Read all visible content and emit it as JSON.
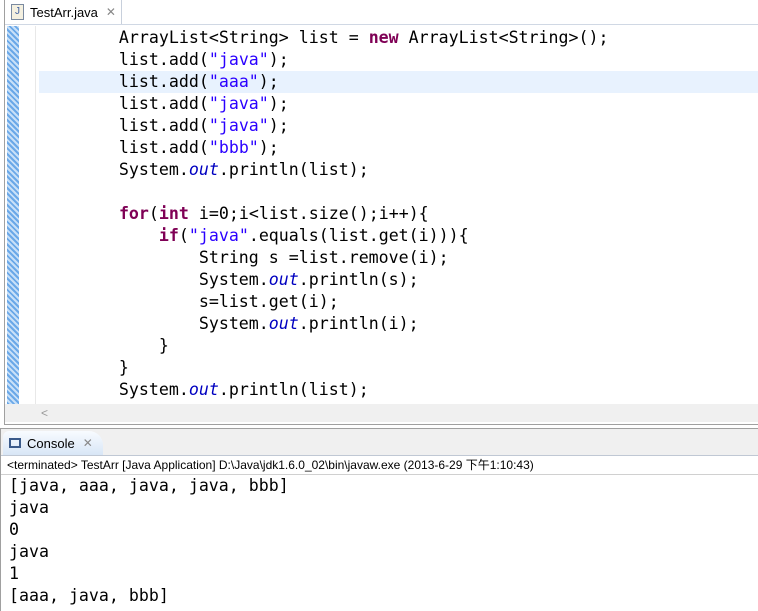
{
  "editor": {
    "tab_label": "TestArr.java",
    "code": [
      [
        [
          "",
          "        ArrayList<String> list = "
        ],
        [
          "kw",
          "new"
        ],
        [
          "",
          " ArrayList<String>();"
        ]
      ],
      [
        [
          "",
          "        list.add("
        ],
        [
          "str",
          "\"java\""
        ],
        [
          "",
          ");"
        ]
      ],
      [
        [
          "",
          "        list.add("
        ],
        [
          "str",
          "\"aaa\""
        ],
        [
          "",
          ");"
        ]
      ],
      [
        [
          "",
          "        list.add("
        ],
        [
          "str",
          "\"java\""
        ],
        [
          "",
          ");"
        ]
      ],
      [
        [
          "",
          "        list.add("
        ],
        [
          "str",
          "\"java\""
        ],
        [
          "",
          ");"
        ]
      ],
      [
        [
          "",
          "        list.add("
        ],
        [
          "str",
          "\"bbb\""
        ],
        [
          "",
          ");"
        ]
      ],
      [
        [
          "",
          "        System."
        ],
        [
          "fld",
          "out"
        ],
        [
          "",
          ".println(list);"
        ]
      ],
      [
        [
          "",
          ""
        ]
      ],
      [
        [
          "",
          "        "
        ],
        [
          "kw",
          "for"
        ],
        [
          "",
          "("
        ],
        [
          "kw",
          "int"
        ],
        [
          "",
          " i=0;i<list.size();i++){"
        ]
      ],
      [
        [
          "",
          "            "
        ],
        [
          "kw",
          "if"
        ],
        [
          "",
          "("
        ],
        [
          "str",
          "\"java\""
        ],
        [
          "",
          ".equals(list.get(i))){"
        ]
      ],
      [
        [
          "",
          "                String s =list.remove(i);"
        ]
      ],
      [
        [
          "",
          "                System."
        ],
        [
          "fld",
          "out"
        ],
        [
          "",
          ".println(s);"
        ]
      ],
      [
        [
          "",
          "                s=list.get(i);"
        ]
      ],
      [
        [
          "",
          "                System."
        ],
        [
          "fld",
          "out"
        ],
        [
          "",
          ".println(i);"
        ]
      ],
      [
        [
          "",
          "            }"
        ]
      ],
      [
        [
          "",
          "        }"
        ]
      ],
      [
        [
          "",
          "        System."
        ],
        [
          "fld",
          "out"
        ],
        [
          "",
          ".println(list);"
        ]
      ]
    ],
    "highlighted_line": 2
  },
  "console": {
    "tab_label": "Console",
    "status": "<terminated> TestArr [Java Application] D:\\Java\\jdk1.6.0_02\\bin\\javaw.exe (2013-6-29 下午1:10:43)",
    "output": [
      "[java, aaa, java, java, bbb]",
      "java",
      "0",
      "java",
      "1",
      "[aaa, java, bbb]"
    ]
  }
}
